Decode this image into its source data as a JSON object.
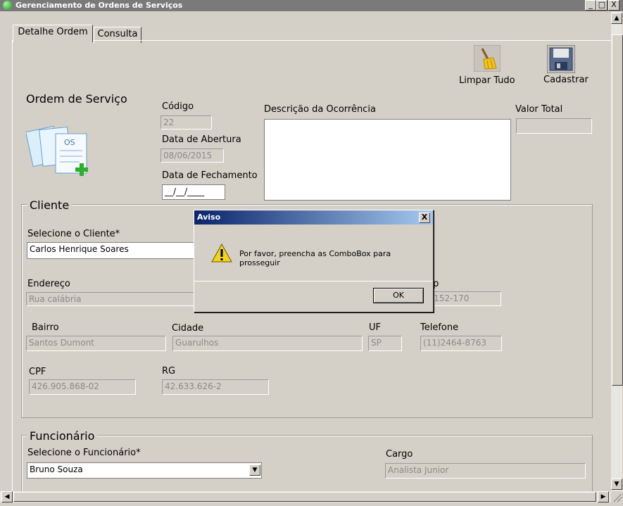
{
  "window": {
    "title": "Gerenciamento de Ordens de Serviços",
    "btn_min": "_",
    "btn_max": "□",
    "btn_close": "X"
  },
  "tabs": [
    {
      "label": "Detalhe Ordem"
    },
    {
      "label": "Consulta"
    }
  ],
  "toolbar": {
    "clear_label": "Limpar Tudo",
    "save_label": "Cadastrar"
  },
  "order": {
    "section_title": "Ordem de Serviço",
    "code_label": "Código",
    "code_value": "22",
    "open_date_label": "Data de Abertura",
    "open_date_value": "08/06/2015",
    "close_date_label": "Data de Fechamento",
    "close_date_value": "__/__/____",
    "description_label": "Descrição da Ocorrência",
    "description_value": "",
    "total_label": "Valor Total",
    "total_value": ""
  },
  "client": {
    "legend": "Cliente",
    "select_label": "Selecione o Cliente*",
    "select_value": "Carlos Henrique Soares",
    "address_label": "Endereço",
    "address_value": "Rua calábria",
    "cep_label": "Cep",
    "cep_value": "07152-170",
    "neighborhood_label": "Bairro",
    "neighborhood_value": "Santos Dumont",
    "city_label": "Cidade",
    "city_value": "Guarulhos",
    "uf_label": "UF",
    "uf_value": "SP",
    "phone_label": "Telefone",
    "phone_value": "(11)2464-8763",
    "cpf_label": "CPF",
    "cpf_value": "426.905.868-02",
    "rg_label": "RG",
    "rg_value": "42.633.626-2"
  },
  "employee": {
    "legend": "Funcionário",
    "select_label": "Selecione o Funcionário*",
    "select_value": "Bruno Souza",
    "role_label": "Cargo",
    "role_value": "Analista Junior"
  },
  "dialog": {
    "title": "Aviso",
    "close": "X",
    "message": "Por favor, preencha as ComboBox para prosseguir",
    "ok_label": "OK"
  }
}
